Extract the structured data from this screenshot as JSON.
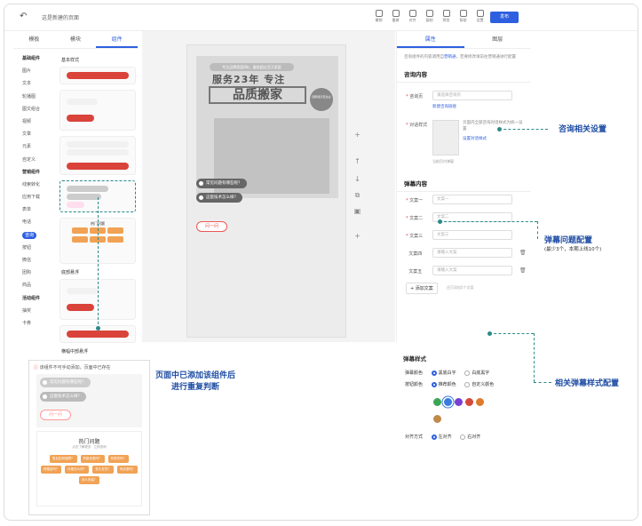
{
  "topbar": {
    "back_icon": "undo-icon",
    "page_title": "这是新建的页面",
    "tools": [
      "撤销",
      "重做",
      "对齐",
      "复制",
      "预览",
      "帮助",
      "设置",
      "保存"
    ],
    "publish_label": "发布"
  },
  "left_panel": {
    "tabs": [
      "模板",
      "模块",
      "组件"
    ],
    "categories": [
      {
        "label": "基础组件",
        "header": true
      },
      {
        "label": "图片"
      },
      {
        "label": "文本"
      },
      {
        "label": "轮播图"
      },
      {
        "label": "图文组合"
      },
      {
        "label": "视频"
      },
      {
        "label": "文章"
      },
      {
        "label": "元素"
      },
      {
        "label": "自定义"
      },
      {
        "label": "营销组件",
        "header": true
      },
      {
        "label": "线索转化"
      },
      {
        "label": "应用下载"
      },
      {
        "label": "表单"
      },
      {
        "label": "电话"
      },
      {
        "label": "咨询",
        "selected": true
      },
      {
        "label": "按钮"
      },
      {
        "label": "微信"
      },
      {
        "label": "团购"
      },
      {
        "label": "商品"
      },
      {
        "label": "活动组件",
        "header": true
      },
      {
        "label": "抽奖"
      },
      {
        "label": "卡券"
      }
    ],
    "section_basic": "基本样式",
    "section_float": "底部悬浮",
    "section_mid": "横幅中部悬浮",
    "hot_title": "热门问题"
  },
  "canvas": {
    "poster_tagline": "专注品牌家居8年，服务超过百万家庭",
    "poster_line1": "服务23年 专注",
    "poster_line2": "品质搬家",
    "poster_badge": "国家级示范企业",
    "bubbles": [
      "常见问题有哪些呢？",
      "这套技术怎么样？"
    ],
    "ask_label": "问一问",
    "side_icons": [
      "plus-icon",
      "arrow-up-icon",
      "arrow-down-icon",
      "copy-icon",
      "trash-icon",
      "add-icon"
    ]
  },
  "right_panel": {
    "tabs": [
      "属性",
      "图层"
    ],
    "notice": "咨询组件的内容调用自",
    "notice_link": "营销通",
    "notice_tail": "，若要修改请前往营销通进行配置",
    "consult_section": "咨询内容",
    "consult_page_label": "咨询页",
    "consult_page_placeholder": "请选择咨询页",
    "new_consult_link": "新建咨询链接",
    "dialog_style_label": "对话样式",
    "dialog_desc": "页面内全部咨询对话样式为统一设置",
    "dialog_link": "设置对话样式",
    "preview_caption": "当前页内弹窗",
    "danmu_section": "弹幕内容",
    "text_rows": [
      {
        "label": "文案一",
        "placeholder": "文案一",
        "required": true
      },
      {
        "label": "文案二",
        "placeholder": "文案二",
        "required": true
      },
      {
        "label": "文案三",
        "placeholder": "文案三",
        "required": true
      },
      {
        "label": "文案四",
        "placeholder": "请输入文案",
        "required": false
      },
      {
        "label": "文案五",
        "placeholder": "请输入文案",
        "required": false
      }
    ],
    "add_button": "+ 添加文案",
    "add_hint": "还可添加5个文案"
  },
  "danmu_style": {
    "title": "弹幕样式",
    "color_label": "弹幕颜色",
    "color_opt1": "黑底白字",
    "color_opt2": "白底黑字",
    "btn_label": "按钮颜色",
    "btn_opt1": "推荐颜色",
    "btn_opt2": "自定义颜色",
    "swatches": [
      "#3aa655",
      "#3a7be0",
      "#7a3fd1",
      "#d44a3a",
      "#e07a2a",
      "#c08a4a"
    ],
    "align_label": "对齐方式",
    "align_opt1": "左对齐",
    "align_opt2": "右对齐"
  },
  "annotations": {
    "consult_settings": "咨询相关设置",
    "danmu_config": "弹幕问题配置",
    "danmu_config_sub": "(最少3个，本期上线10个)",
    "style_config": "相关弹幕样式配置",
    "dedupe_line1": "页面中已添加该组件后",
    "dedupe_line2": "进行重复判断"
  },
  "warning_card": {
    "warning": "该组件不可手动添加，页面中已存在",
    "bubbles": [
      "常见问题有哪些呢？",
      "这套技术怎么样？"
    ],
    "ask_label": "问一问",
    "hot_title": "热门问题",
    "hot_sub": "点击了解更多 · 立即咨询",
    "hot_items": [
      "售后如何保障？",
      "有新优惠吗？",
      "有现货吗？",
      "有赠品吗？",
      "价格怎么样？",
      "多久发货？",
      "有优惠吗？",
      "怎么安装？"
    ]
  }
}
